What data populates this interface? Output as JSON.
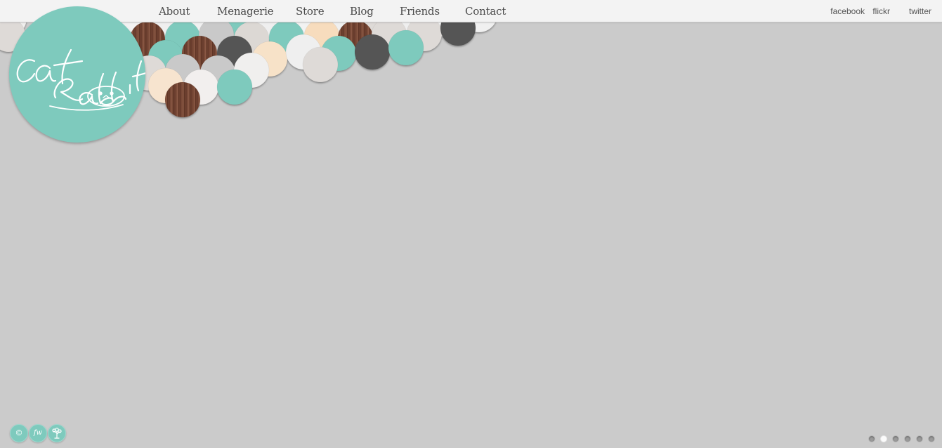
{
  "nav": {
    "about": "About",
    "menagerie": "Menagerie",
    "store": "Store",
    "blog": "Blog",
    "friends": "Friends",
    "contact": "Contact"
  },
  "social": {
    "facebook": "facebook",
    "flickr": "flickr",
    "twitter": "twitter"
  },
  "logo": {
    "line1": "cat",
    "line2": "Rabbit",
    "icon": "cat-rabbit-logo-icon"
  },
  "footer_badges": [
    {
      "label": "©",
      "icon": "copyright-icon"
    },
    {
      "label": "fw",
      "icon": "fw-icon"
    },
    {
      "label": "",
      "icon": "tree-icon"
    }
  ],
  "slideshow": {
    "total": 6,
    "active_index": 1
  },
  "colors": {
    "background": "#cbcbcb",
    "topbar": "#f3f3f3",
    "teal": "#7ecabd",
    "white": "#f2f2f2",
    "light_gray": "#dedad7",
    "mid_gray": "#c9c9c9",
    "dark_gray": "#555555",
    "peach": "#f7dfc2",
    "wood": "#7a4b38"
  }
}
